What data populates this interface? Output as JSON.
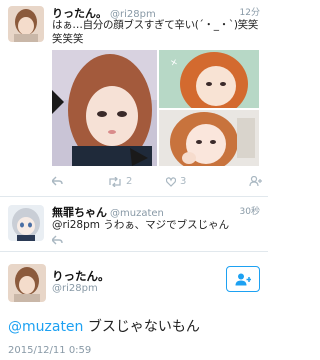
{
  "tweet1": {
    "name": "りったん。",
    "handle": "@ri28pm",
    "time": "12分",
    "text_line1": "はぁ…自分の顔ブスすぎて辛い(´・_・`)笑笑",
    "text_line2": "笑笑笑",
    "retweets": "2",
    "likes": "3"
  },
  "tweet2": {
    "name": "無罪ちゃん",
    "handle": "@muzaten",
    "time": "30秒",
    "text": "@ri28pm うわぁ、マジでブスじゃん"
  },
  "detail": {
    "name": "りったん。",
    "handle": "@ri28pm",
    "mention": "@muzaten",
    "reply_text": "ブスじゃないもん",
    "timestamp": "2015/12/11 0:59"
  },
  "colors": {
    "accent": "#1da1f2",
    "gray": "#8899a6",
    "separator": "#e1e8ed"
  }
}
